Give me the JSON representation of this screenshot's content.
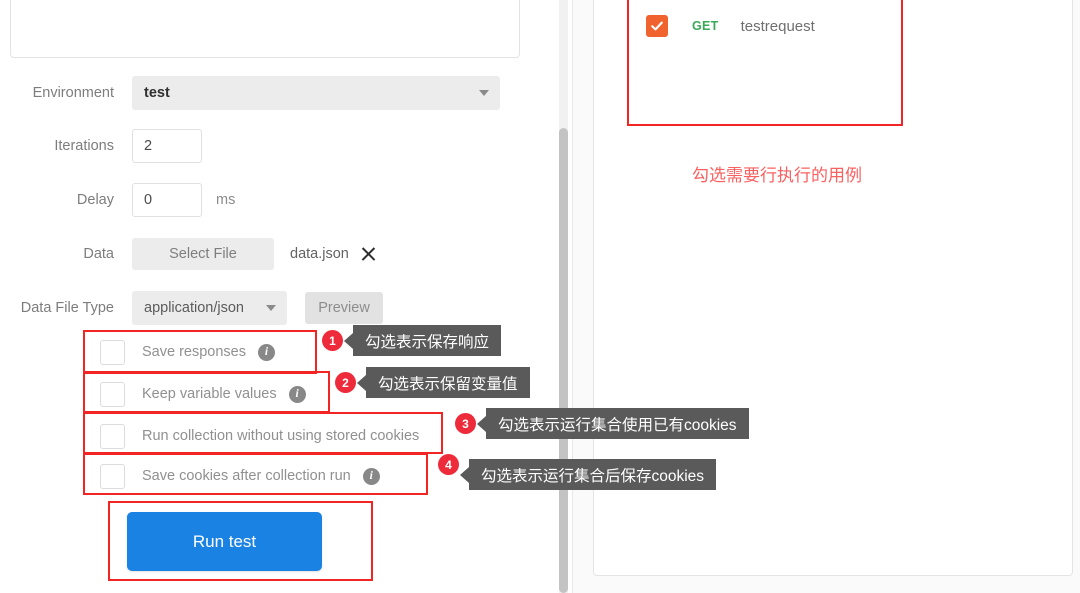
{
  "left_form": {
    "rows": [
      {
        "label": "Environment",
        "value": "test",
        "control": "select",
        "icon": "chevron-down-icon"
      },
      {
        "label": "Iterations",
        "value": "2",
        "control": "input"
      },
      {
        "label": "Delay",
        "value": "0",
        "control": "input",
        "unit": "ms"
      },
      {
        "label": "Data",
        "button_label": "Select File",
        "filename": "data.json",
        "clear_icon": "close-x-icon"
      },
      {
        "label": "Data File Type",
        "value": "application/json",
        "preview_label": "Preview",
        "icon": "chevron-down-icon"
      }
    ],
    "checkboxes": [
      {
        "label": "Save responses",
        "checked": false,
        "has_info": true,
        "info_icon": "info-circle-icon"
      },
      {
        "label": "Keep variable values",
        "checked": false,
        "has_info": true,
        "info_icon": "info-circle-icon"
      },
      {
        "label": "Run collection without using stored cookies",
        "checked": false,
        "has_info": false
      },
      {
        "label": "Save cookies after collection run",
        "checked": false,
        "has_info": true,
        "info_icon": "info-circle-icon"
      }
    ],
    "run_button_label": "Run test"
  },
  "annotations": {
    "badges": [
      "1",
      "2",
      "3",
      "4"
    ],
    "tooltips": [
      "勾选表示保存响应",
      "勾选表示保留变量值",
      "勾选表示运行集合使用已有cookies",
      "勾选表示运行集合后保存cookies"
    ]
  },
  "right_panel": {
    "request": {
      "checked": true,
      "check_icon": "checkmark-icon",
      "method": "GET",
      "name": "testrequest"
    },
    "note": "勾选需要行执行的用例"
  },
  "colors": {
    "annotation_red": "#f22424",
    "badge_red": "#ee2b3b",
    "tooltip_gray": "#5a5a5a",
    "run_button_blue": "#1a82e2",
    "checkbox_orange": "#f0622e",
    "method_green": "#3ba95a",
    "note_red": "#fa6060"
  }
}
